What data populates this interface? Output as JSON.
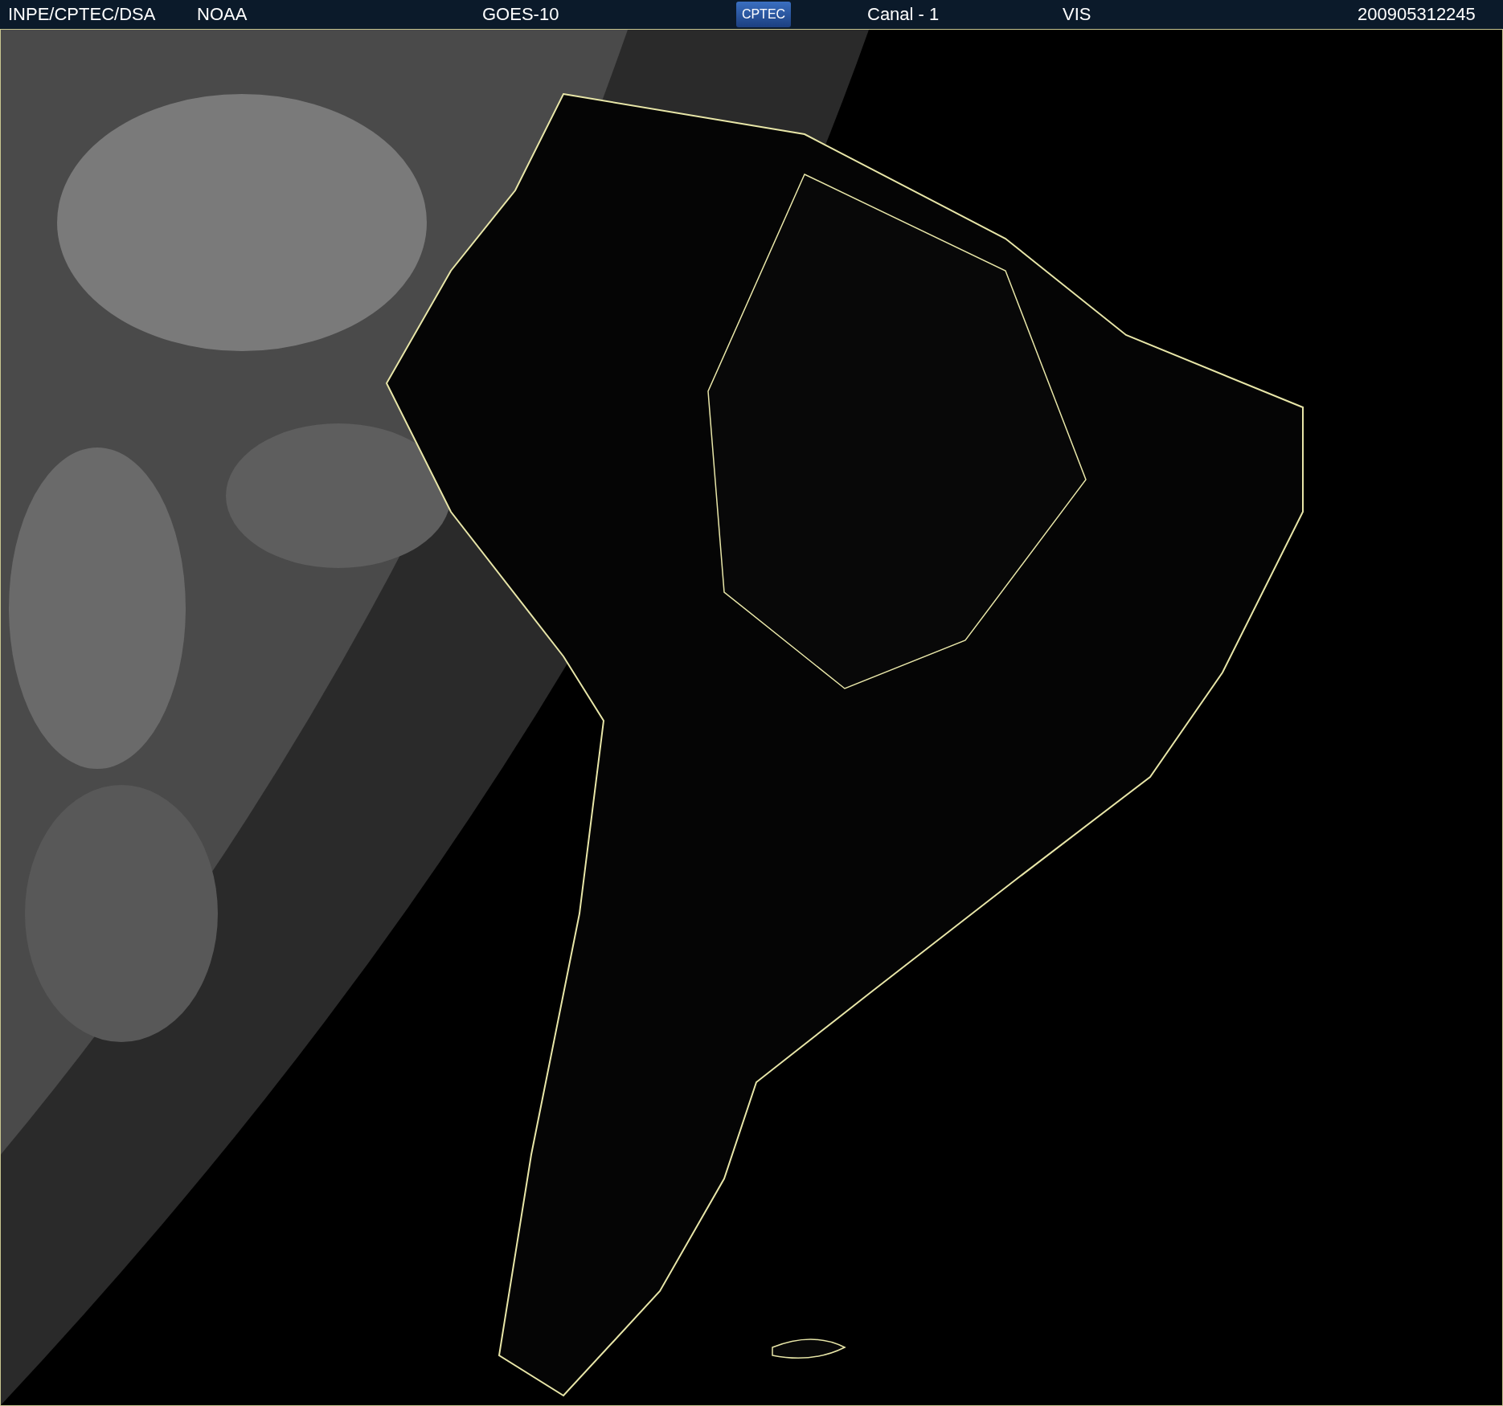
{
  "header": {
    "source": "INPE/CPTEC/DSA",
    "agency": "NOAA",
    "satellite": "GOES-10",
    "logo": "CPTEC",
    "channel": "Canal - 1",
    "band": "VIS",
    "timestamp": "200905312245"
  }
}
